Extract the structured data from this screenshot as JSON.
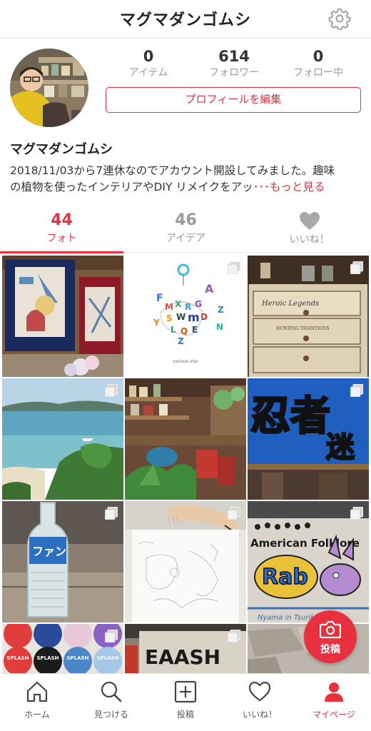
{
  "header": {
    "title": "マグマダンゴムシ",
    "settings_icon": "gear-icon"
  },
  "stats": [
    {
      "value": "0",
      "label": "アイテム"
    },
    {
      "value": "614",
      "label": "フォロワー"
    },
    {
      "value": "0",
      "label": "フォロー中"
    }
  ],
  "profile": {
    "edit_label": "プロフィールを編集",
    "name": "マグマダンゴムシ",
    "bio_line1": "2018/11/03から7連休なのでアカウント開設してみました。趣味",
    "bio_line2": "の植物を使ったインテリアやDIY リメイクをアッ",
    "more_label": "･･･もっと見る"
  },
  "tabs": [
    {
      "count": "44",
      "label": "フォト",
      "active": true
    },
    {
      "count": "46",
      "label": "アイデア",
      "active": false
    },
    {
      "label": "いいね！",
      "icon": "heart-icon",
      "active": false
    }
  ],
  "photos": [
    "framed-alice-art",
    "various-star-graphic",
    "heroic-legends-drawer",
    "beach-bay-landscape",
    "cafe-interior-plants",
    "ninja-maze-sign",
    "fanta-glass-bottle",
    "pencil-sketch-drawing",
    "american-folklore-rabbit-graffiti",
    "splash-coasters",
    "graffiti-wall",
    "stone-paving"
  ],
  "various_star_caption": "various star",
  "fab": {
    "label": "投稿",
    "icon": "camera-icon",
    "color": "#e8303e"
  },
  "tabbar": [
    {
      "label": "ホーム",
      "icon": "home-icon",
      "active": false
    },
    {
      "label": "見つける",
      "icon": "search-icon",
      "active": false
    },
    {
      "label": "投稿",
      "icon": "plus-square-icon",
      "active": false
    },
    {
      "label": "いいね！",
      "icon": "heart-icon",
      "active": false
    },
    {
      "label": "マイページ",
      "icon": "person-icon",
      "active": true
    }
  ],
  "colors": {
    "accent": "#e8303e",
    "muted": "#9a9a9a"
  }
}
